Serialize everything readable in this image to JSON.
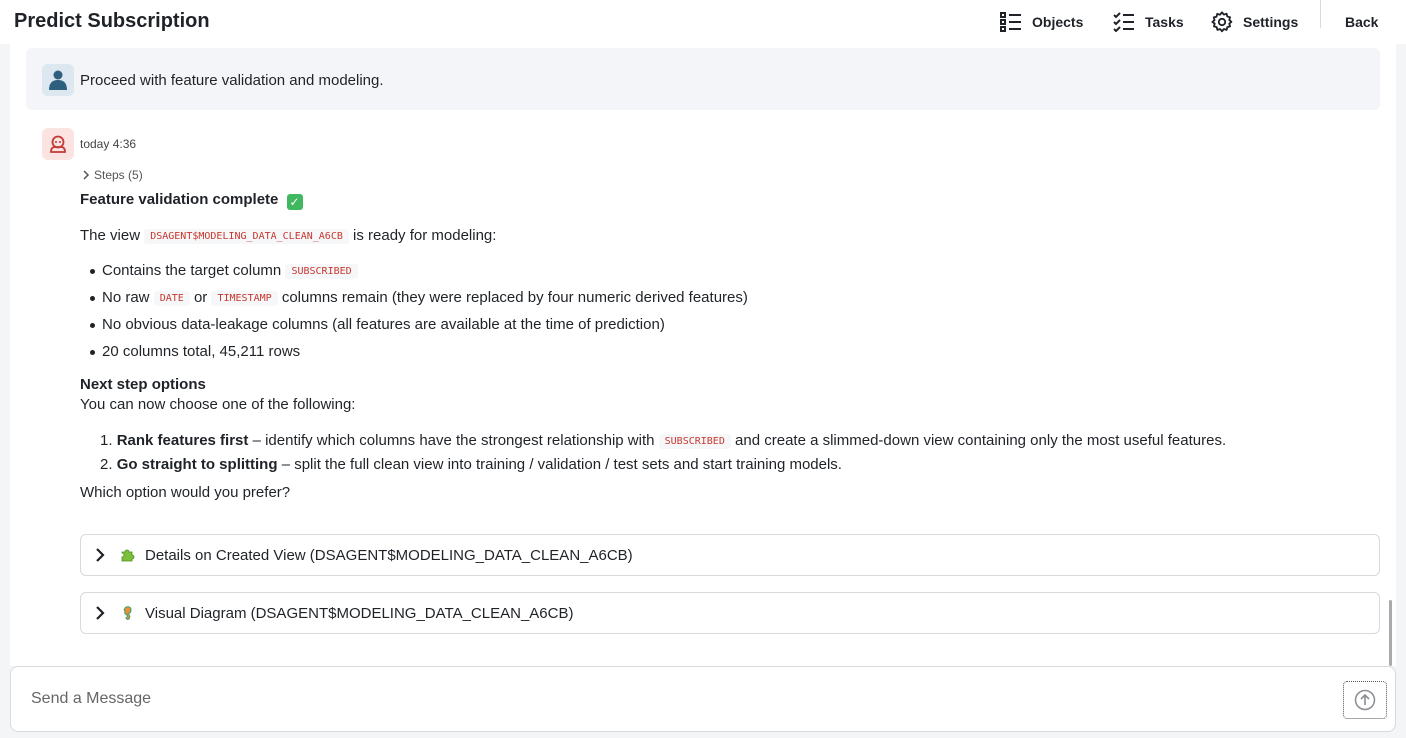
{
  "app": {
    "title": "Predict Subscription"
  },
  "nav": {
    "objects": "Objects",
    "tasks": "Tasks",
    "settings": "Settings",
    "back": "Back"
  },
  "user_message": {
    "text": "Proceed with feature validation and modeling."
  },
  "assistant_message": {
    "timestamp": "today 4:36",
    "steps_label": "Steps (5)",
    "heading": "Feature validation complete",
    "intro_prefix": "The view",
    "intro_code": "DSAGENT$MODELING_DATA_CLEAN_A6CB",
    "intro_suffix": "is ready for modeling:",
    "bullet1_prefix": "Contains the target column",
    "bullet1_code": "SUBSCRIBED",
    "bullet2_prefix": "No raw",
    "bullet2_code1": "DATE",
    "bullet2_or": "or",
    "bullet2_code2": "TIMESTAMP",
    "bullet2_suffix": "columns remain (they were replaced by four numeric derived features)",
    "bullet3": "No obvious data-leakage columns (all features are available at the time of prediction)",
    "bullet4": "20 columns total, 45,211 rows",
    "next_heading": "Next step options",
    "next_intro": "You can now choose one of the following:",
    "opt1_num": "1.",
    "opt1_bold": "Rank features first",
    "opt1_text": "– identify which columns have the strongest relationship with",
    "opt1_code": "SUBSCRIBED",
    "opt1_text2": "and create a slimmed-down view containing only the most useful features.",
    "opt2_num": "2.",
    "opt2_bold": "Go straight to splitting",
    "opt2_text": "– split the full clean view into training / validation / test sets and start training models.",
    "question": "Which option would you prefer?"
  },
  "expanders": {
    "details": {
      "icon": "puzzle-icon",
      "label": "Details on Created View (DSAGENT$MODELING_DATA_CLEAN_A6CB)"
    },
    "diagram": {
      "icon": "seahorse-icon",
      "label": "Visual Diagram (DSAGENT$MODELING_DATA_CLEAN_A6CB)"
    }
  },
  "composer": {
    "placeholder": "Send a Message"
  },
  "colors": {
    "code": "#c7372f",
    "check": "#3fb85f"
  }
}
